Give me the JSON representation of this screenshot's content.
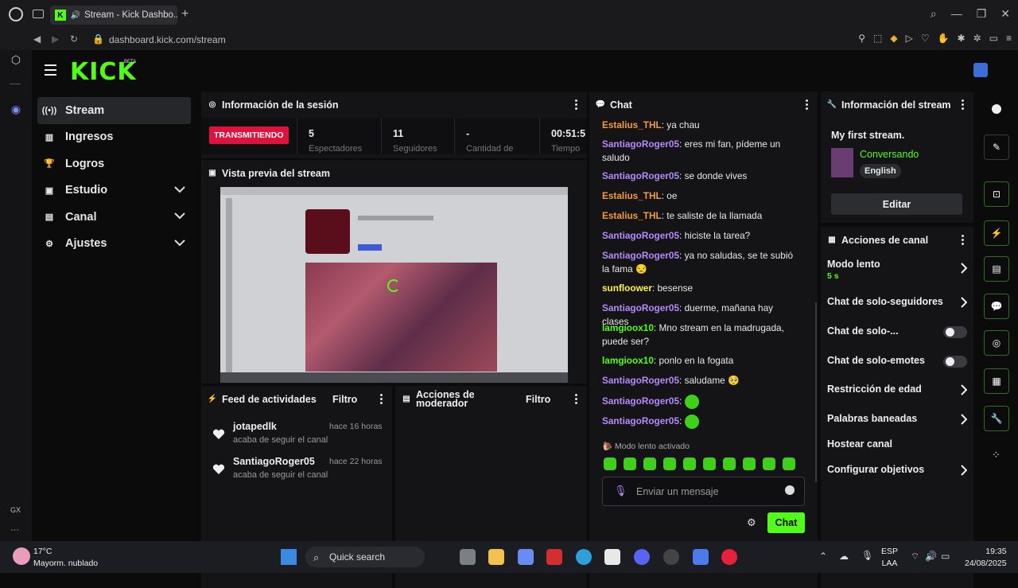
{
  "browser": {
    "tab_title": "Stream - Kick Dashbo...",
    "url": "dashboard.kick.com/stream",
    "new_tab": "+"
  },
  "app": {
    "logo": "KICK",
    "beta": "BETA"
  },
  "nav": [
    {
      "label": "Stream",
      "icon": "broadcast-icon",
      "active": true
    },
    {
      "label": "Ingresos",
      "icon": "chart-icon"
    },
    {
      "label": "Logros",
      "icon": "trophy-icon"
    },
    {
      "label": "Estudio",
      "icon": "camera-icon",
      "expand": true
    },
    {
      "label": "Canal",
      "icon": "person-icon",
      "expand": true
    },
    {
      "label": "Ajustes",
      "icon": "gear-icon",
      "expand": true
    }
  ],
  "session": {
    "title": "Información de la sesión",
    "status": "TRANSMITIENDO",
    "stats": [
      {
        "value": "5",
        "label": "Espectadores"
      },
      {
        "value": "11",
        "label": "Seguidores"
      },
      {
        "value": "-",
        "label": "Cantidad de"
      },
      {
        "value": "00:51:5",
        "label": "Tiempo"
      }
    ]
  },
  "preview": {
    "title": "Vista previa del stream"
  },
  "activity": {
    "title": "Feed de actividades",
    "filter": "Filtro",
    "items": [
      {
        "name": "jotapedlk",
        "action": "acaba de seguir el canal",
        "time": "hace 16 horas"
      },
      {
        "name": "SantiagoRoger05",
        "action": "acaba de seguir el canal",
        "time": "hace 22 horas"
      }
    ]
  },
  "moderator": {
    "title": "Acciones de moderador",
    "filter": "Filtro"
  },
  "chat": {
    "title": "Chat",
    "messages": [
      {
        "user": "Estalius_THL",
        "color": "orange",
        "text": "ya chau"
      },
      {
        "user": "SantiagoRoger05",
        "color": "purple",
        "text": "eres mi fan, pídeme un saludo"
      },
      {
        "user": "SantiagoRoger05",
        "color": "purple",
        "text": "se donde vives"
      },
      {
        "user": "Estalius_THL",
        "color": "orange",
        "text": "oe"
      },
      {
        "user": "Estalius_THL",
        "color": "orange",
        "text": "te saliste de la llamada"
      },
      {
        "user": "SantiagoRoger05",
        "color": "purple",
        "text": "hiciste la tarea?"
      },
      {
        "user": "SantiagoRoger05",
        "color": "purple",
        "text": "ya no saludas, se te subió la fama 😒"
      },
      {
        "user": "sunfloower",
        "color": "yellow",
        "text": "besense"
      },
      {
        "user": "SantiagoRoger05",
        "color": "purple",
        "text": "duerme, mañana hay clases"
      },
      {
        "user": "lamgioox10",
        "color": "green",
        "text": "Mno stream en la madrugada, puede ser?"
      },
      {
        "user": "lamgioox10",
        "color": "green",
        "text": "ponlo en la fogata"
      },
      {
        "user": "SantiagoRoger05",
        "color": "purple",
        "text": "saludame 🥺"
      },
      {
        "user": "SantiagoRoger05",
        "color": "purple",
        "text": ""
      },
      {
        "user": "SantiagoRoger05",
        "color": "purple",
        "text": ""
      }
    ],
    "slow_mode_notice": "Modo lento activado",
    "input_placeholder": "Enviar un mensaje",
    "send_label": "Chat"
  },
  "stream_info": {
    "title": "Información del stream",
    "stream_title": "My first stream.",
    "category": "Conversando",
    "language": "English",
    "edit_label": "Editar"
  },
  "channel_actions": {
    "title": "Acciones de canal",
    "items": [
      {
        "label": "Modo lento",
        "sub": "5 s",
        "control": "arrow"
      },
      {
        "label": "Chat de solo-seguidores",
        "control": "arrow"
      },
      {
        "label": "Chat de solo-...",
        "control": "toggle"
      },
      {
        "label": "Chat de solo-emotes",
        "control": "toggle"
      },
      {
        "label": "Restricción de edad",
        "control": "arrow"
      },
      {
        "label": "Palabras baneadas",
        "control": "arrow"
      },
      {
        "label": "Hostear canal",
        "control": "none"
      },
      {
        "label": "Configurar objetivos",
        "control": "arrow"
      }
    ]
  },
  "colors": {
    "accent": "#53fc18",
    "live": "#e2103d",
    "panel": "#141416",
    "bg": "#0b0b0c"
  },
  "taskbar": {
    "temp": "17°C",
    "weather": "Mayorm. nublado",
    "search": "Quick search",
    "lang1": "ESP",
    "lang2": "LAA",
    "time": "19:35",
    "date": "24/08/2025"
  },
  "sidebar": {
    "gx": "GX",
    "more": "···"
  }
}
